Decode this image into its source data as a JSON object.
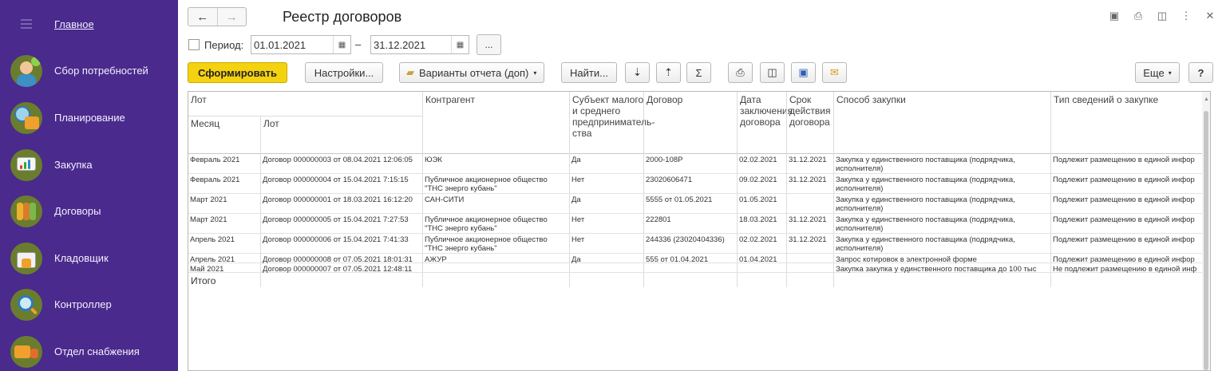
{
  "sidebar": {
    "home": "Главное",
    "items": [
      {
        "label": "Сбор потребностей",
        "icon": "person-icon",
        "color": "#6a7d2e"
      },
      {
        "label": "Планирование",
        "icon": "calendar-clock-icon",
        "color": "#6a7d2e"
      },
      {
        "label": "Закупка",
        "icon": "chart-board-icon",
        "color": "#6a7d2e"
      },
      {
        "label": "Договоры",
        "icon": "folders-icon",
        "color": "#6a7d2e"
      },
      {
        "label": "Кладовщик",
        "icon": "warehouse-icon",
        "color": "#6a7d2e"
      },
      {
        "label": "Контроллер",
        "icon": "magnifier-icon",
        "color": "#6a7d2e"
      },
      {
        "label": "Отдел снабжения",
        "icon": "truck-icon",
        "color": "#6a7d2e"
      }
    ]
  },
  "header": {
    "title": "Реестр договоров",
    "back": "←",
    "forward": "→"
  },
  "period": {
    "label": "Период:",
    "from": "01.01.2021",
    "to": "31.12.2021",
    "dash": "–",
    "more": "..."
  },
  "toolbar": {
    "generate": "Сформировать",
    "settings": "Настройки...",
    "variants": "Варианты отчета (доп)",
    "find": "Найти...",
    "more": "Еще",
    "help": "?"
  },
  "table": {
    "group_header": "Лот",
    "sub_month": "Месяц",
    "sub_lot": "Лот",
    "col_counterparty": "Контрагент",
    "col_smb": "Субъект малого и среднего предприниматель­ства",
    "col_contract": "Договор",
    "col_date": "Дата заключения договора",
    "col_term": "Срок действия договора",
    "col_method": "Способ закупки",
    "col_info": "Тип сведений о закупке",
    "rows": [
      {
        "month": "Февраль 2021",
        "lot": "Договор 000000003 от 08.04.2021 12:06:05",
        "cp": "ЮЭК",
        "smb": "Да",
        "contract": "2000-108Р",
        "date": "02.02.2021",
        "term": "31.12.2021",
        "method": "Закупка у единственного поставщика (подрядчика, исполнителя)",
        "info": "Подлежит размещению в единой инфор"
      },
      {
        "month": "Февраль 2021",
        "lot": "Договор 000000004 от 15.04.2021 7:15:15",
        "cp": "Публичное акционерное общество \"ТНС энерго кубань\"",
        "smb": "Нет",
        "contract": "23020606471",
        "date": "09.02.2021",
        "term": "31.12.2021",
        "method": "Закупка у единственного поставщика (подрядчика, исполнителя)",
        "info": "Подлежит размещению в единой инфор"
      },
      {
        "month": "Март 2021",
        "lot": "Договор 000000001 от 18.03.2021 16:12:20",
        "cp": "САН-СИТИ",
        "smb": "Да",
        "contract": "5555 от 01.05.2021",
        "date": "01.05.2021",
        "term": "",
        "method": "Закупка у единственного поставщика (подрядчика, исполнителя)",
        "info": "Подлежит размещению в единой инфор"
      },
      {
        "month": "Март 2021",
        "lot": "Договор 000000005 от 15.04.2021 7:27:53",
        "cp": "Публичное акционерное общество \"ТНС энерго кубань\"",
        "smb": "Нет",
        "contract": "222801",
        "date": "18.03.2021",
        "term": "31.12.2021",
        "method": "Закупка у единственного поставщика (подрядчика, исполнителя)",
        "info": "Подлежит размещению в единой инфор"
      },
      {
        "month": "Апрель 2021",
        "lot": "Договор 000000006 от 15.04.2021 7:41:33",
        "cp": "Публичное акционерное общество \"ТНС энерго кубань\"",
        "smb": "Нет",
        "contract": "244336 (23020404336)",
        "date": "02.02.2021",
        "term": "31.12.2021",
        "method": "Закупка у единственного поставщика (подрядчика, исполнителя)",
        "info": "Подлежит размещению в единой инфор"
      },
      {
        "month": "Апрель 2021",
        "lot": "Договор 000000008 от 07.05.2021 18:01:31",
        "cp": "АЖУР",
        "smb": "Да",
        "contract": "555 от 01.04.2021",
        "date": "01.04.2021",
        "term": "",
        "method": "Запрос котировок в электронной форме",
        "info": "Подлежит размещению в единой инфор"
      },
      {
        "month": "Май 2021",
        "lot": "Договор 000000007 от 07.05.2021 12:48:11",
        "cp": "",
        "smb": "",
        "contract": "",
        "date": "",
        "term": "",
        "method": "Закупка закупка у единственного поставщика до 100 тыс",
        "info": "Не подлежит размещению в единой инф"
      }
    ],
    "total": "Итого"
  },
  "colors": {
    "sidebar_bg": "#4a2a8c",
    "accent_button": "#f5d20f",
    "icon_circle": "#6a7d2e"
  }
}
